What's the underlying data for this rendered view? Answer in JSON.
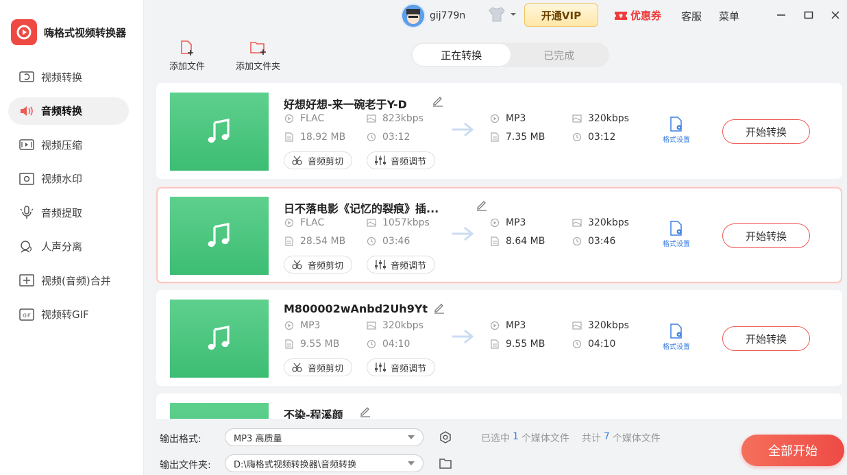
{
  "app": {
    "title": "嗨格式视频转换器"
  },
  "sidebar": {
    "items": [
      {
        "label": "视频转换",
        "icon": "video-convert-icon",
        "active": false
      },
      {
        "label": "音频转换",
        "icon": "audio-convert-icon",
        "active": true
      },
      {
        "label": "视频压缩",
        "icon": "video-compress-icon",
        "active": false
      },
      {
        "label": "视频水印",
        "icon": "watermark-icon",
        "active": false
      },
      {
        "label": "音频提取",
        "icon": "audio-extract-icon",
        "active": false
      },
      {
        "label": "人声分离",
        "icon": "vocal-separate-icon",
        "active": false
      },
      {
        "label": "视频(音频)合并",
        "icon": "merge-icon",
        "active": false
      },
      {
        "label": "视频转GIF",
        "icon": "gif-icon",
        "active": false
      }
    ]
  },
  "topbar": {
    "username": "gij779n",
    "vip_label": "开通VIP",
    "coupon_label": "优惠券",
    "service_label": "客服",
    "menu_label": "菜单"
  },
  "toolbar": {
    "add_file": "添加文件",
    "add_folder": "添加文件夹",
    "tabs": [
      {
        "label": "正在转换",
        "active": true
      },
      {
        "label": "已完成",
        "active": false
      }
    ]
  },
  "files": [
    {
      "name": "好想好想-来一碗老于Y-D",
      "src_format": "FLAC",
      "src_bitrate": "823kbps",
      "src_size": "18.92 MB",
      "src_duration": "03:12",
      "out_format": "MP3",
      "out_bitrate": "320kbps",
      "out_size": "7.35 MB",
      "out_duration": "03:12",
      "selected": false
    },
    {
      "name": "日不落电影《记忆的裂痕》插...",
      "src_format": "FLAC",
      "src_bitrate": "1057kbps",
      "src_size": "28.54 MB",
      "src_duration": "03:46",
      "out_format": "MP3",
      "out_bitrate": "320kbps",
      "out_size": "8.64 MB",
      "out_duration": "03:46",
      "selected": true
    },
    {
      "name": "M800002wAnbd2Uh9Yt",
      "src_format": "MP3",
      "src_bitrate": "320kbps",
      "src_size": "9.55 MB",
      "src_duration": "04:10",
      "out_format": "MP3",
      "out_bitrate": "320kbps",
      "out_size": "9.55 MB",
      "out_duration": "04:10",
      "selected": false
    },
    {
      "name": "不染-程溪颜",
      "selected": false
    }
  ],
  "card_labels": {
    "cut": "音频剪切",
    "adjust": "音频调节",
    "format_settings": "格式设置",
    "start": "开始转换"
  },
  "bottom": {
    "output_format_label": "输出格式:",
    "output_format_value": "MP3 高质量",
    "output_folder_label": "输出文件夹:",
    "output_folder_value": "D:\\嗨格式视频转换器\\音频转换",
    "selected_prefix": "已选中",
    "selected_count": "1",
    "selected_suffix": "个媒体文件",
    "total_prefix": "共计",
    "total_count": "7",
    "total_suffix": "个媒体文件",
    "start_all": "全部开始"
  },
  "colors": {
    "accent": "#ee4b45",
    "link": "#3d7fe0",
    "thumb": "#4cc67f"
  }
}
